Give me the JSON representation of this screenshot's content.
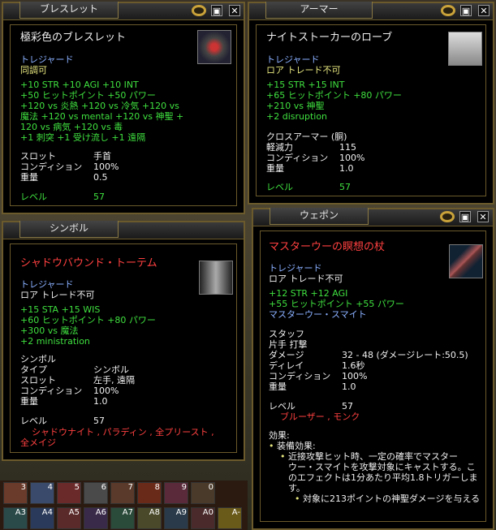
{
  "bracelet": {
    "tab": "ブレスレット",
    "name": "極彩色のブレスレット",
    "tier": "トレジャード",
    "flags": "同調可",
    "stats": [
      "+10 STR  +10 AGI  +10 INT",
      "+50 ヒットポイント  +50 パワー",
      "+120 vs 炎熱 +120 vs 冷気 +120 vs",
      "魔法 +120 vs mental +120 vs 神聖 +",
      "120 vs 病気 +120 vs 毒",
      "+1 刺突  +1 受け流し  +1 遠隔"
    ],
    "slot_label": "スロット",
    "slot_value": "手首",
    "cond_label": "コンディション",
    "cond_value": "100%",
    "weight_label": "重量",
    "weight_value": "0.5",
    "level_label": "レベル",
    "level_value": "57"
  },
  "armor": {
    "tab": "アーマー",
    "name": "ナイトストーカーのローブ",
    "tier": "トレジャード",
    "flags": "ロア トレード不可",
    "stats": [
      "+15 STR  +15 INT",
      "+65 ヒットポイント  +80 パワー",
      "+210 vs 神聖",
      "+2 disruption"
    ],
    "type_line": "クロスアーマー (胴)",
    "mit_label": "軽減力",
    "mit_value": "115",
    "cond_label": "コンディション",
    "cond_value": "100%",
    "weight_label": "重量",
    "weight_value": "1.0",
    "level_label": "レベル",
    "level_value": "57"
  },
  "symbol": {
    "tab": "シンボル",
    "name": "シャドウバウンド・トーテム",
    "tier": "トレジャード",
    "flags": "ロア トレード不可",
    "stats": [
      "+15 STA  +15 WIS",
      "+60 ヒットポイント  +80 パワー",
      "+300 vs 魔法",
      "+2 ministration"
    ],
    "type_head": "シンボル",
    "type_label": "タイプ",
    "type_value": "シンボル",
    "slot_label": "スロット",
    "slot_value": "左手, 遠隔",
    "cond_label": "コンディション",
    "cond_value": "100%",
    "weight_label": "重量",
    "weight_value": "1.0",
    "level_label": "レベル",
    "level_value": "57",
    "classes_1": "シャドウナイト  , パラディン , 全プリースト ,",
    "classes_2": "全メイジ"
  },
  "weapon": {
    "tab": "ウェポン",
    "name": "マスターウーの瞑想の杖",
    "tier": "トレジャード",
    "flags": "ロア トレード不可",
    "stats": [
      "+12 STR  +12 AGI",
      "+55 ヒットポイント  +55 パワー"
    ],
    "proc_name": "マスターウー・スマイト",
    "type_head": "スタッフ",
    "type_sub": "片手 打撃",
    "dmg_label": "ダメージ",
    "dmg_value": "32 - 48  (ダメージレート:50.5)",
    "delay_label": "ディレイ",
    "delay_value": "1.6秒",
    "cond_label": "コンディション",
    "cond_value": "100%",
    "weight_label": "重量",
    "weight_value": "1.0",
    "level_label": "レベル",
    "level_value": "57",
    "classes": "ブルーザー    , モンク",
    "effects_head": "効果:",
    "effect_1": "装備効果:",
    "effect_2": "近接攻撃ヒット時、一定の確率でマスター",
    "effect_3": "ウー・スマイトを攻撃対象にキャストする。こ",
    "effect_4": "のエフェクトは1分あたり平均1.8トリガーしま",
    "effect_5": "す。",
    "effect_6": "対象に213ポイントの神聖ダメージを与える"
  },
  "hotbar": {
    "row1": [
      "3",
      "4",
      "5",
      "6",
      "7",
      "8",
      "9",
      "0"
    ],
    "row2": [
      "A3",
      "A4",
      "A5",
      "A6",
      "A7",
      "A8",
      "A9",
      "A0",
      "A-"
    ]
  },
  "buttons": {
    "min": "▣",
    "close": "✕"
  }
}
